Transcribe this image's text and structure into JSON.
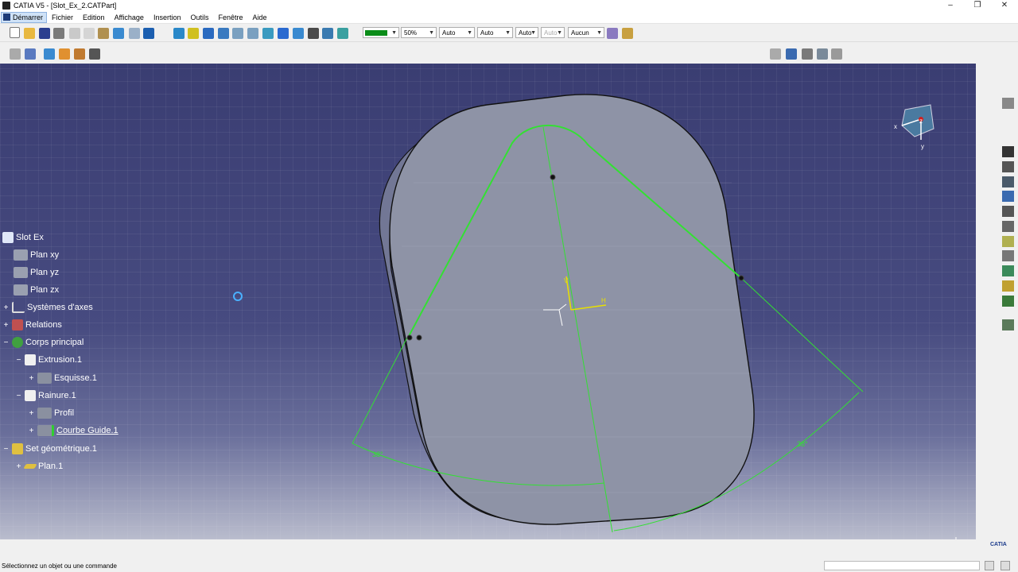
{
  "window": {
    "title": "CATIA V5 - [Slot_Ex_2.CATPart]",
    "buttons": [
      "–",
      "❐",
      "✕"
    ]
  },
  "menubar": {
    "start_label": "Démarrer",
    "items": [
      "Fichier",
      "Edition",
      "Affichage",
      "Insertion",
      "Outils",
      "Fenêtre",
      "Aide"
    ]
  },
  "toolbar": {
    "color_combo": "",
    "transparency": "50%",
    "line_thickness": "Auto",
    "line_type": "Auto",
    "point_type": "Auto",
    "layer_disabled": "Auto",
    "render_style": "Aucun"
  },
  "tree": {
    "root": "Slot Ex",
    "items": [
      {
        "label": "Plan xy"
      },
      {
        "label": "Plan yz"
      },
      {
        "label": "Plan zx"
      },
      {
        "label": "Systèmes d'axes"
      },
      {
        "label": "Relations"
      },
      {
        "label": "Corps principal"
      },
      {
        "label": "Extrusion.1"
      },
      {
        "label": "Esquisse.1"
      },
      {
        "label": "Rainure.1"
      },
      {
        "label": "Profil"
      },
      {
        "label": "Courbe Guide.1"
      },
      {
        "label": "Set géométrique.1"
      },
      {
        "label": "Plan.1"
      }
    ]
  },
  "viewport": {
    "dimension_left": "38°",
    "dimension_right": "38°",
    "axis_h": "H",
    "axis_v": "V",
    "compass_x": "x",
    "compass_y": "y",
    "compass_z": "z"
  },
  "status": {
    "message": "Sélectionnez un objet ou une commande"
  },
  "logo": "CATIA",
  "colors": {
    "viewport_top": "#3a3d72",
    "sketch_green": "#33e033",
    "body_gray": "#8e93a6"
  }
}
